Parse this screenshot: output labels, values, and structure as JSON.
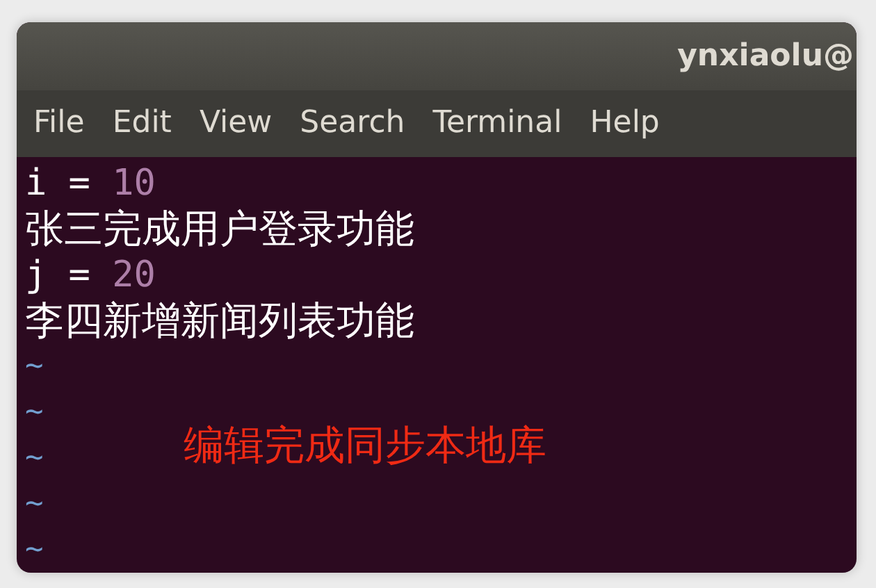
{
  "window": {
    "title": "ynxiaolu@"
  },
  "menu": [
    {
      "label": "File"
    },
    {
      "label": "Edit"
    },
    {
      "label": "View"
    },
    {
      "label": "Search"
    },
    {
      "label": "Terminal"
    },
    {
      "label": "Help"
    }
  ],
  "lines": [
    {
      "kind": "assign",
      "name": "i",
      "op": "=",
      "value": "10"
    },
    {
      "kind": "text",
      "text": "张三完成用户登录功能"
    },
    {
      "kind": "assign",
      "name": "j",
      "op": "=",
      "value": "20"
    },
    {
      "kind": "text",
      "text": "李四新增新闻列表功能"
    },
    {
      "kind": "empty",
      "marker": "~"
    },
    {
      "kind": "empty",
      "marker": "~"
    },
    {
      "kind": "empty",
      "marker": "~"
    },
    {
      "kind": "empty",
      "marker": "~"
    },
    {
      "kind": "empty",
      "marker": "~"
    }
  ],
  "annotation": {
    "text": "编辑完成同步本地库"
  }
}
